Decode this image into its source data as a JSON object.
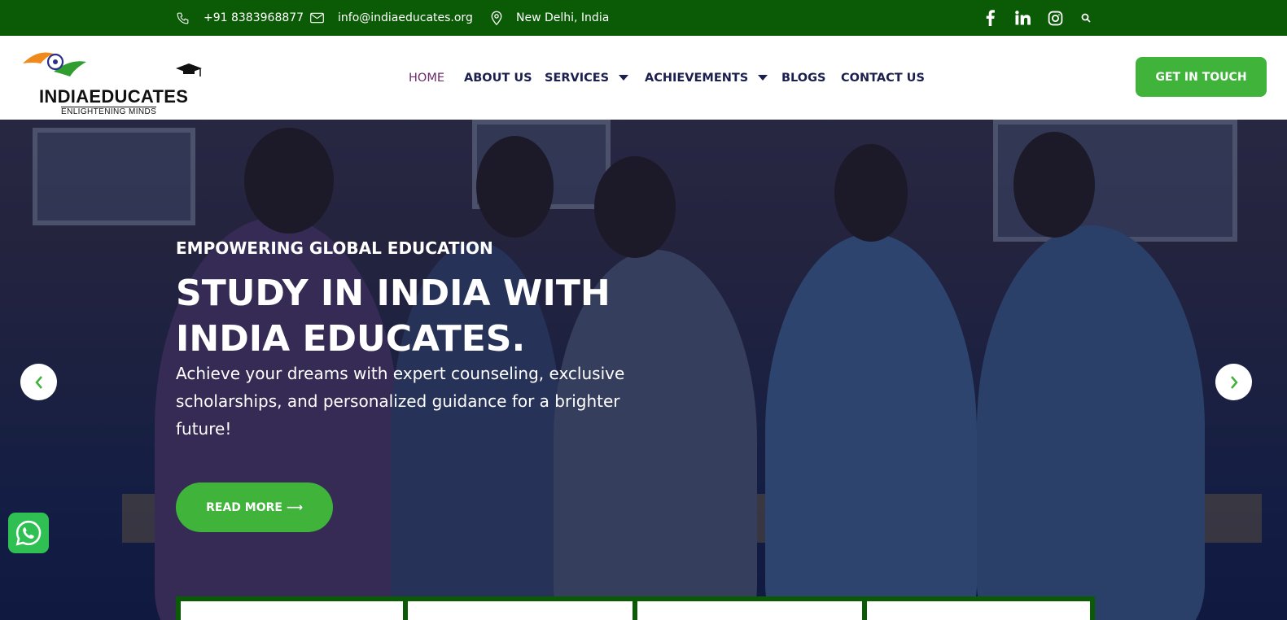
{
  "topbar": {
    "phone": "+91 8383968877",
    "email": "info@indiaeducates.org",
    "location": "New Delhi, India",
    "icons": [
      "phone-icon",
      "mail-icon",
      "location-pin-icon",
      "facebook-icon",
      "linkedin-icon",
      "instagram-icon",
      "search-icon"
    ]
  },
  "logo": {
    "name": "INDIAEDUCATES",
    "tagline": "ENLIGHTENING   MINDS"
  },
  "nav": {
    "home": "HOME",
    "about": "ABOUT US",
    "services": "SERVICES",
    "achievements": "ACHIEVEMENTS",
    "blogs": "BLOGS",
    "contact": "CONTACT US"
  },
  "cta_label": "GET IN TOUCH",
  "hero": {
    "eyebrow": "EMPOWERING GLOBAL EDUCATION",
    "headline": "STUDY IN INDIA WITH INDIA EDUCATES.",
    "description": "Achieve your dreams with expert counseling, exclusive scholarships, and personalized guidance for a brighter future!",
    "read_more": "READ MORE ⟶"
  },
  "colors": {
    "topbar": "#0a5a06",
    "accent_green": "#3fb33a",
    "nav_text": "#1a1f4e",
    "nav_active": "#6b2a6a",
    "whatsapp": "#2fbf52"
  }
}
